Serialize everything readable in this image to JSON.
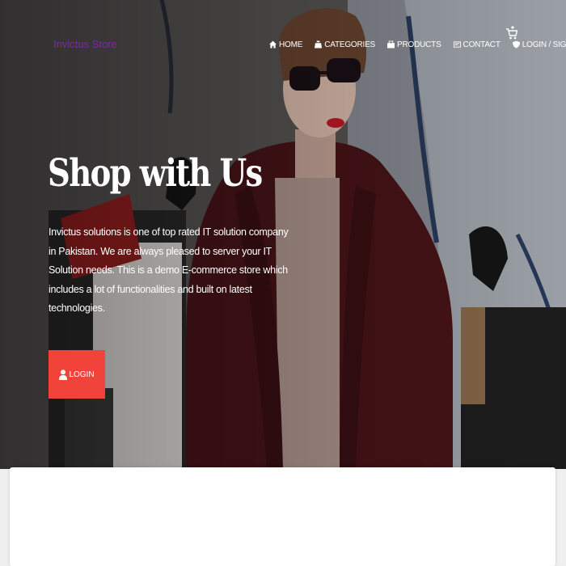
{
  "brand": "Invictus Store",
  "nav": {
    "home": "HOME",
    "categories": "CATEGORIES",
    "products": "PRODUCTS",
    "contact": "CONTACT",
    "login_signup": "LOGIN / SIGNUP"
  },
  "icons": {
    "home": "home-icon",
    "categories": "categories-icon",
    "products": "products-icon",
    "contact": "contact-icon",
    "login": "shield-user-icon",
    "cart": "cart-icon",
    "button_user": "user-icon"
  },
  "hero": {
    "title": "Shop with Us",
    "text": "Invictus solutions is one of top rated IT solution company in Pakistan. We are always pleased to server your IT Solution needs. This is a demo E-commerce store which includes a lot of functionalities and built on latest technologies.",
    "button_label": "LOGIN"
  },
  "colors": {
    "brand": "#7d2a9c",
    "accent_button": "#f1433a",
    "nav_text": "#ffffff"
  }
}
